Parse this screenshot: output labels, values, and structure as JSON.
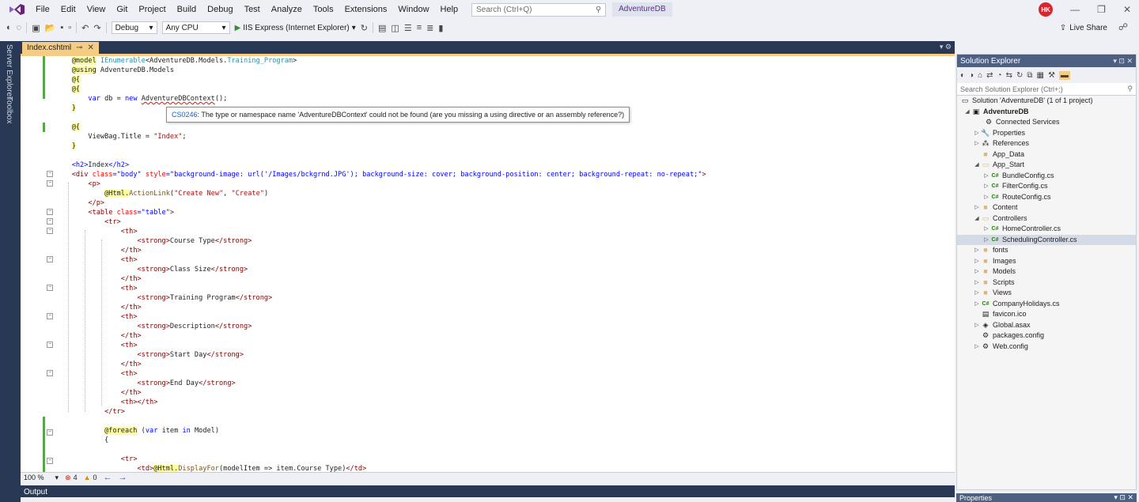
{
  "menu": {
    "items": [
      "File",
      "Edit",
      "View",
      "Git",
      "Project",
      "Build",
      "Debug",
      "Test",
      "Analyze",
      "Tools",
      "Extensions",
      "Window",
      "Help"
    ],
    "search_placeholder": "Search (Ctrl+Q)",
    "solution_name": "AdventureDB",
    "avatar_initials": "HK"
  },
  "toolbar": {
    "config": "Debug",
    "platform": "Any CPU",
    "run_target": "IIS Express (Internet Explorer)",
    "live_share": "Live Share"
  },
  "left_tabs": [
    "Server Explorer",
    "Toolbox"
  ],
  "editor": {
    "tab_title": "Index.cshtml",
    "tooltip_code": "CS0246",
    "tooltip_message": ": The type or namespace name 'AdventureDBContext' could not be found (are you missing a using directive or an assembly reference?)",
    "zoom": "100 %",
    "errors": "4",
    "warnings": "0"
  },
  "output": {
    "title": "Output"
  },
  "solution_explorer": {
    "title": "Solution Explorer",
    "search_placeholder": "Search Solution Explorer (Ctrl+;)",
    "items": [
      {
        "label": "Solution 'AdventureDB' (1 of 1 project)",
        "icon": "solution-icon"
      },
      {
        "label": "AdventureDB",
        "icon": "project-icon"
      },
      {
        "label": "Connected Services",
        "icon": "connected-services-icon"
      },
      {
        "label": "Properties",
        "icon": "wrench-icon"
      },
      {
        "label": "References",
        "icon": "references-icon"
      },
      {
        "label": "App_Data",
        "icon": "folder-icon"
      },
      {
        "label": "App_Start",
        "icon": "folder-open-icon"
      },
      {
        "label": "BundleConfig.cs",
        "icon": "csharp-file-icon"
      },
      {
        "label": "FilterConfig.cs",
        "icon": "csharp-file-icon"
      },
      {
        "label": "RouteConfig.cs",
        "icon": "csharp-file-icon"
      },
      {
        "label": "Content",
        "icon": "folder-icon"
      },
      {
        "label": "Controllers",
        "icon": "folder-open-icon"
      },
      {
        "label": "HomeController.cs",
        "icon": "csharp-file-icon"
      },
      {
        "label": "SchedulingController.cs",
        "icon": "csharp-file-icon"
      },
      {
        "label": "fonts",
        "icon": "folder-icon"
      },
      {
        "label": "Images",
        "icon": "folder-icon"
      },
      {
        "label": "Models",
        "icon": "folder-icon"
      },
      {
        "label": "Scripts",
        "icon": "folder-icon"
      },
      {
        "label": "Views",
        "icon": "folder-icon"
      },
      {
        "label": "CompanyHolidays.cs",
        "icon": "csharp-file-icon"
      },
      {
        "label": "favicon.ico",
        "icon": "file-icon"
      },
      {
        "label": "Global.asax",
        "icon": "global-asax-icon"
      },
      {
        "label": "packages.config",
        "icon": "config-file-icon"
      },
      {
        "label": "Web.config",
        "icon": "config-file-icon"
      }
    ]
  },
  "properties": {
    "title": "Properties"
  },
  "code": {
    "l1a": "@model",
    "l1b": " IEnumerable",
    "l1c": "<AdventureDB.Models.",
    "l1d": "Training_Program",
    "l1e": ">",
    "l2a": "@using",
    "l2b": " AdventureDB.Models",
    "l3": "@{",
    "l4": "@{",
    "l5a": "var",
    "l5b": " db = ",
    "l5c": "new",
    "l5d": " ",
    "l5e": "AdventureDBContext",
    "l5f": "();",
    "l6": "}",
    "l7": "@{",
    "l8a": "ViewBag.Title = ",
    "l8b": "\"Index\"",
    "l8c": ";",
    "l9": "}",
    "l10a": "<h2>",
    "l10b": "Index",
    "l10c": "</h2>",
    "l11a": "<div",
    "l11b": " class",
    "l11c": "=\"body\"",
    "l11d": " style",
    "l11e": "=\"background-image: url('/Images/bckgrnd.JPG'); background-size: cover; background-position: center; background-repeat: no-repeat;\"",
    "l11f": ">",
    "l12": "<p>",
    "l13a": "@Html.",
    "l13b": "ActionLink",
    "l13c": "(",
    "l13d": "\"Create New\"",
    "l13e": ", ",
    "l13f": "\"Create\"",
    "l13g": ")",
    "l14": "</p>",
    "l15a": "<table",
    "l15b": " class",
    "l15c": "=\"table\"",
    "l15d": ">",
    "l16": "<tr>",
    "th_open": "<th>",
    "th_close": "</th>",
    "strong_open": "<strong>",
    "strong_close": "</strong>",
    "h1": "Course Type",
    "h2": "Class Size",
    "h3": "Training Program",
    "h4": "Description",
    "h5": "Start Day",
    "h6": "End Day",
    "l_thth": "<th></th>",
    "l_trclose": "</tr>",
    "l_foreach_a": "@foreach",
    "l_foreach_b": " (",
    "l_foreach_c": "var",
    "l_foreach_d": " item ",
    "l_foreach_e": "in",
    "l_foreach_f": " Model)",
    "l_brace": "{",
    "l_tr2": "<tr>",
    "l_td_a": "<td>",
    "l_td_b": "@Html.",
    "l_td_c": "DisplayFor",
    "l_td_d": "(modelItem => item.Course Type)",
    "l_td_e": "</td>"
  },
  "colors": {
    "accent": "#293955",
    "tab_active": "#f5cc84",
    "error": "#e51400",
    "warning": "#d29200"
  }
}
